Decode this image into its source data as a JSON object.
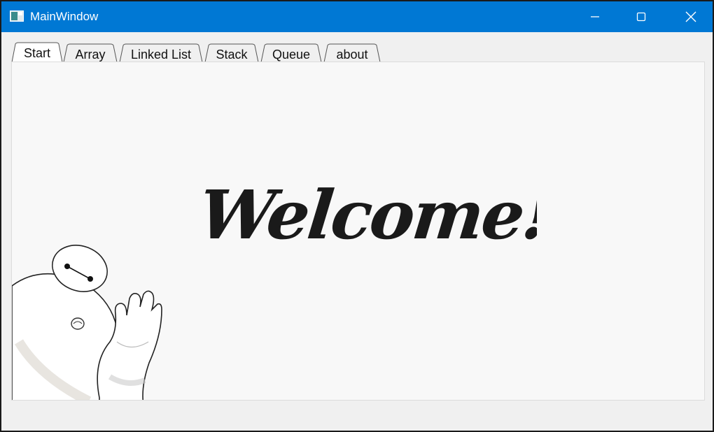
{
  "window": {
    "title": "MainWindow",
    "icons": {
      "app": "window-app-icon",
      "minimize": "minimize-icon",
      "maximize": "maximize-icon",
      "close": "close-icon"
    },
    "colors": {
      "titlebar": "#0078d4",
      "background": "#f0f0f0",
      "pane": "#f8f8f8"
    }
  },
  "tabs": [
    {
      "label": "Start",
      "active": true
    },
    {
      "label": "Array",
      "active": false
    },
    {
      "label": "Linked List",
      "active": false
    },
    {
      "label": "Stack",
      "active": false
    },
    {
      "label": "Queue",
      "active": false
    },
    {
      "label": "about",
      "active": false
    }
  ],
  "start_page": {
    "welcome_text": "Welcome!",
    "illustration": "baymax-waving-illustration"
  }
}
